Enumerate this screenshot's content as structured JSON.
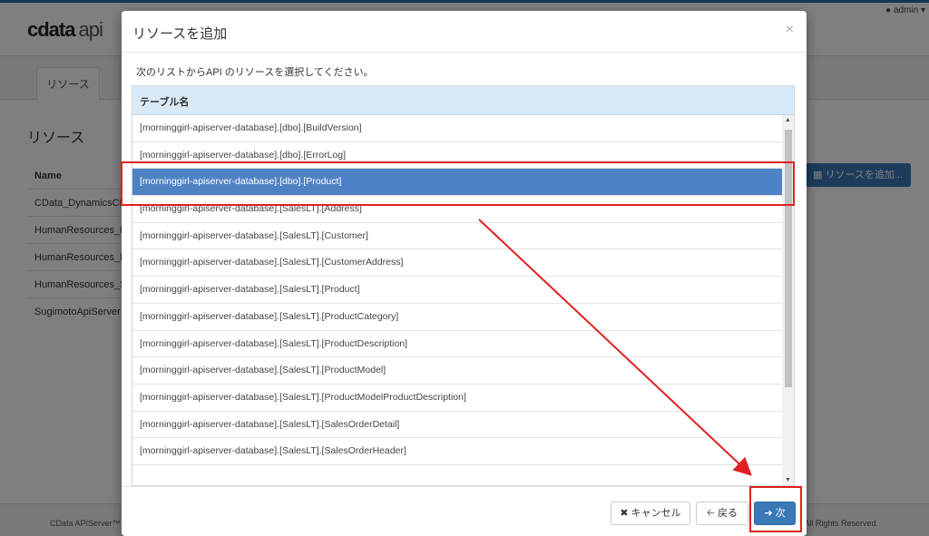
{
  "app": {
    "logo_text": "cdata",
    "logo_api": "api",
    "user": "admin",
    "tab": "リソース",
    "heading": "リソース",
    "column_name": "Name",
    "rows": [
      "CData_DynamicsCRM",
      "HumanResources_D",
      "HumanResources_E",
      "HumanResources_S",
      "SugimotoApiServer"
    ],
    "add_button": "リソースを追加...",
    "footer_left": "CData APIServer™",
    "footer_right": "All Rights Reserved."
  },
  "modal": {
    "title": "リソースを追加",
    "close": "×",
    "description": "次のリストからAPI のリソースを選択してください。",
    "column_header": "テーブル名",
    "selected_index": 2,
    "rows": [
      "[morninggirl-apiserver-database].[dbo].[BuildVersion]",
      "[morninggirl-apiserver-database].[dbo].[ErrorLog]",
      "[morninggirl-apiserver-database].[dbo].[Product]",
      "[morninggirl-apiserver-database].[SalesLT].[Address]",
      "[morninggirl-apiserver-database].[SalesLT].[Customer]",
      "[morninggirl-apiserver-database].[SalesLT].[CustomerAddress]",
      "[morninggirl-apiserver-database].[SalesLT].[Product]",
      "[morninggirl-apiserver-database].[SalesLT].[ProductCategory]",
      "[morninggirl-apiserver-database].[SalesLT].[ProductDescription]",
      "[morninggirl-apiserver-database].[SalesLT].[ProductModel]",
      "[morninggirl-apiserver-database].[SalesLT].[ProductModelProductDescription]",
      "[morninggirl-apiserver-database].[SalesLT].[SalesOrderDetail]",
      "[morninggirl-apiserver-database].[SalesLT].[SalesOrderHeader]"
    ],
    "buttons": {
      "cancel": "キャンセル",
      "back": "戻る",
      "next": "次"
    }
  },
  "colors": {
    "selected_row": "#4f82c4",
    "primary": "#3a78b8",
    "annotation": "#e02020",
    "table_header": "#d9e9f5"
  }
}
